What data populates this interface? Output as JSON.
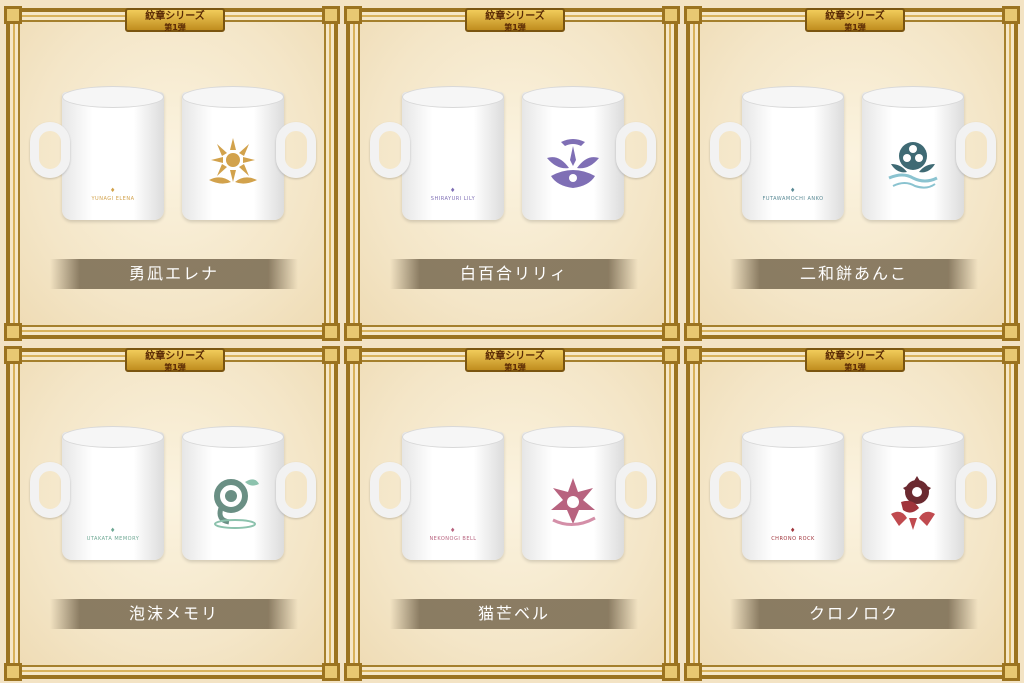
{
  "banner": {
    "title": "紋章シリーズ",
    "sub": "第1弾"
  },
  "cards": [
    {
      "name": "勇凪エレナ",
      "mug_text": "YUNAGI ELENA",
      "color": "#d2a24c",
      "icon": "sun-emblem-icon"
    },
    {
      "name": "白百合リリィ",
      "mug_text": "SHIRAYURI LILY",
      "color": "#7f6fb5",
      "icon": "wing-emblem-icon"
    },
    {
      "name": "二和餅あんこ",
      "mug_text": "FUTAWAMOCHI ANKO",
      "color": "#5a8a95",
      "icon": "flower-wave-emblem-icon"
    },
    {
      "name": "泡沫メモリ",
      "mug_text": "UTAKATA MEMORY",
      "color": "#6fa894",
      "icon": "bubble-emblem-icon"
    },
    {
      "name": "猫芒ベル",
      "mug_text": "NEKONOGI BELL",
      "color": "#b8637f",
      "icon": "star-flower-emblem-icon"
    },
    {
      "name": "クロノロク",
      "mug_text": "CHRONO ROCK",
      "color": "#a0343b",
      "icon": "gear-emblem-icon"
    }
  ]
}
